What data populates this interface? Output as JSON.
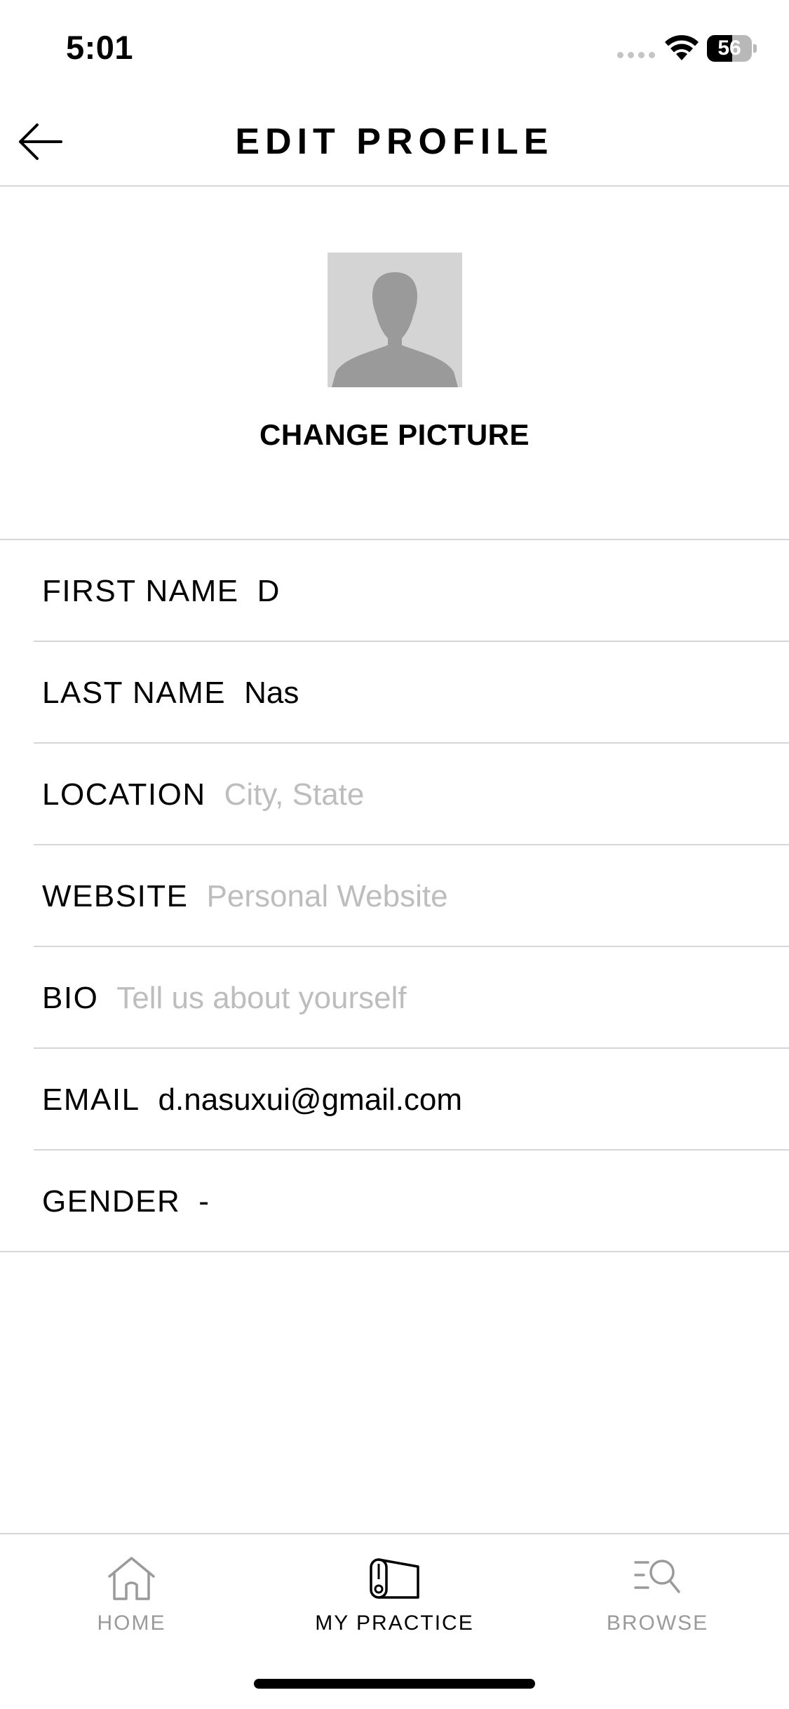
{
  "status_bar": {
    "time": "5:01",
    "battery_percent": 56,
    "battery_label": "56"
  },
  "header": {
    "title": "EDIT PROFILE",
    "back_icon": "arrow-left-icon"
  },
  "profile": {
    "avatar_icon": "person-silhouette-icon",
    "change_picture_label": "CHANGE PICTURE"
  },
  "fields": [
    {
      "label": "FIRST NAME",
      "value": "D",
      "placeholder": ""
    },
    {
      "label": "LAST NAME",
      "value": "Nas",
      "placeholder": ""
    },
    {
      "label": "LOCATION",
      "value": "",
      "placeholder": "City, State"
    },
    {
      "label": "WEBSITE",
      "value": "",
      "placeholder": "Personal Website"
    },
    {
      "label": "BIO",
      "value": "",
      "placeholder": "Tell us about yourself"
    },
    {
      "label": "EMAIL",
      "value": "d.nasuxui@gmail.com",
      "placeholder": ""
    },
    {
      "label": "GENDER",
      "value": "-",
      "placeholder": ""
    }
  ],
  "tab_bar": {
    "tabs": [
      {
        "label": "HOME",
        "icon": "home-icon",
        "active": false
      },
      {
        "label": "MY PRACTICE",
        "icon": "yoga-mat-icon",
        "active": true
      },
      {
        "label": "BROWSE",
        "icon": "browse-search-icon",
        "active": false
      }
    ]
  },
  "colors": {
    "text": "#000000",
    "placeholder": "#bdbdbd",
    "divider": "#d6d6d6",
    "inactive_tab": "#9a9a9a",
    "avatar_bg": "#d4d4d4",
    "avatar_figure": "#9a9a9a"
  }
}
